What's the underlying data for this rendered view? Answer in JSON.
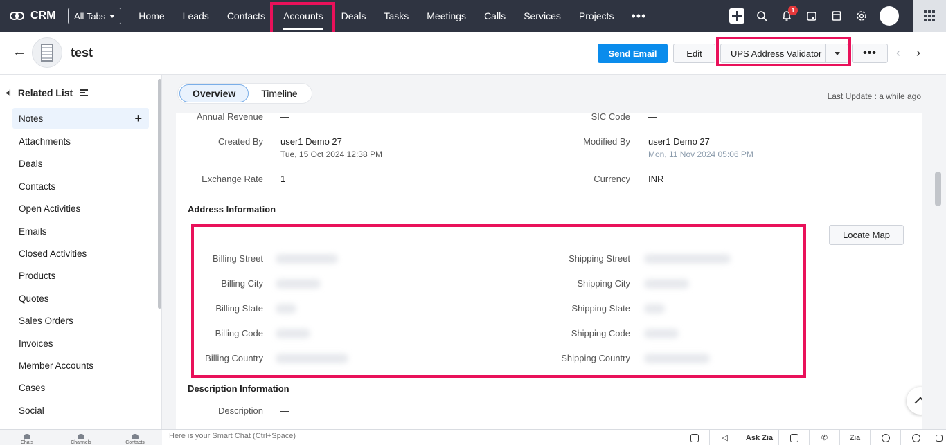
{
  "topnav": {
    "brand": "CRM",
    "all_tabs": "All Tabs",
    "tabs": [
      "Home",
      "Leads",
      "Contacts",
      "Accounts",
      "Deals",
      "Tasks",
      "Meetings",
      "Calls",
      "Services",
      "Projects"
    ],
    "active_tab": "Accounts",
    "more": "•••",
    "notification_count": "1"
  },
  "record": {
    "back": "←",
    "title": "test",
    "send_email": "Send Email",
    "edit": "Edit",
    "ups_validator": "UPS Address Validator",
    "more": "•••",
    "prev": "‹",
    "next": "›"
  },
  "sidebar": {
    "heading": "Related List",
    "items": [
      "Notes",
      "Attachments",
      "Deals",
      "Contacts",
      "Open Activities",
      "Emails",
      "Closed Activities",
      "Products",
      "Quotes",
      "Sales Orders",
      "Invoices",
      "Member Accounts",
      "Cases",
      "Social"
    ],
    "add": "+"
  },
  "main": {
    "view_tabs": [
      "Overview",
      "Timeline"
    ],
    "last_update": "Last Update : a while ago"
  },
  "fields": {
    "annual_revenue_label": "Annual Revenue",
    "annual_revenue_value": "—",
    "sic_code_label": "SIC Code",
    "sic_code_value": "—",
    "created_by_label": "Created By",
    "created_by_value": "user1 Demo 27",
    "created_by_time": "Tue, 15 Oct 2024 12:38 PM",
    "modified_by_label": "Modified By",
    "modified_by_value": "user1 Demo 27",
    "modified_by_time": "Mon, 11 Nov 2024 05:06 PM",
    "exchange_rate_label": "Exchange Rate",
    "exchange_rate_value": "1",
    "currency_label": "Currency",
    "currency_value": "INR"
  },
  "address": {
    "heading": "Address Information",
    "locate_map": "Locate Map",
    "billing_labels": [
      "Billing Street",
      "Billing City",
      "Billing State",
      "Billing Code",
      "Billing Country"
    ],
    "shipping_labels": [
      "Shipping Street",
      "Shipping City",
      "Shipping State",
      "Shipping Code",
      "Shipping Country"
    ]
  },
  "description": {
    "heading": "Description Information",
    "label": "Description",
    "value": "—"
  },
  "bottombar": {
    "left_items": [
      "Chats",
      "Channels",
      "Contacts"
    ],
    "smart_chat_placeholder": "Here is your Smart Chat (Ctrl+Space)",
    "ask_zia": "Ask Zia",
    "zia": "Zia"
  },
  "colors": {
    "nav_bg": "#2f3441",
    "primary": "#0a8cec",
    "highlight": "#e9115a"
  }
}
